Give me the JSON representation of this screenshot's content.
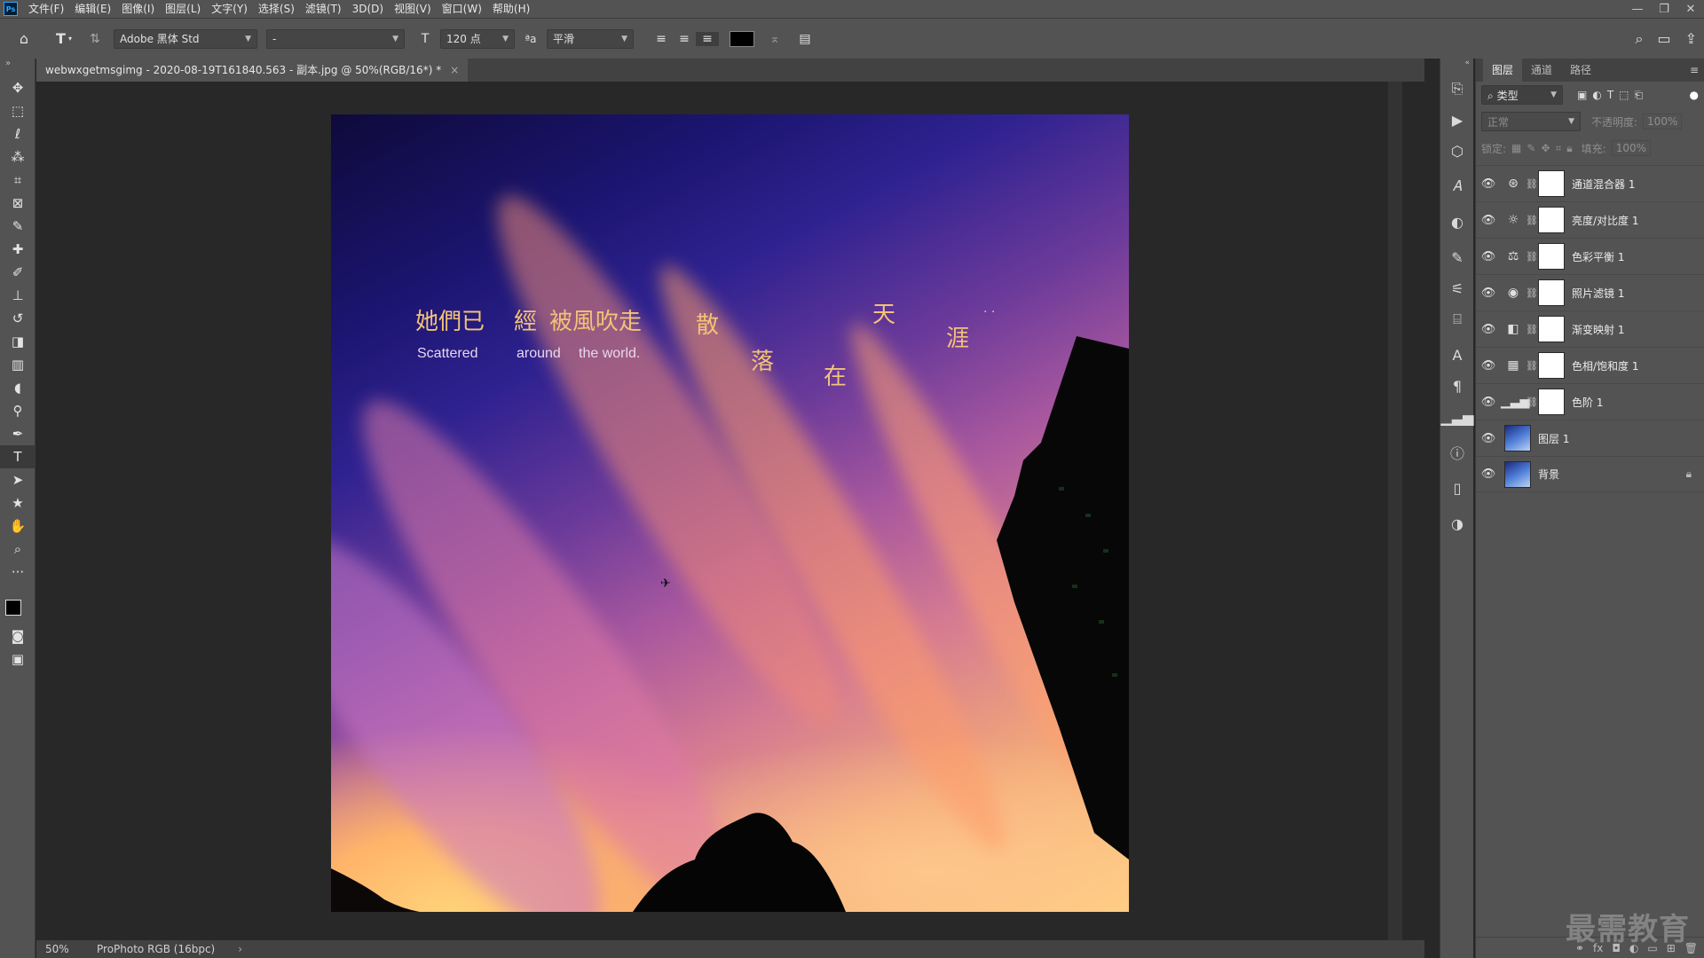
{
  "menubar": {
    "logo": "Ps",
    "items": [
      "文件(F)",
      "编辑(E)",
      "图像(I)",
      "图层(L)",
      "文字(Y)",
      "选择(S)",
      "滤镜(T)",
      "3D(D)",
      "视图(V)",
      "窗口(W)",
      "帮助(H)"
    ]
  },
  "options": {
    "font_family": "Adobe 黑体 Std",
    "font_style": "-",
    "font_size": "120 点",
    "antialias": "平滑",
    "text_color": "#000000"
  },
  "document": {
    "tab_title": "webwxgetmsgimg - 2020-08-19T161840.563 - 副本.jpg @ 50%(RGB/16*) *",
    "zoom": "50%",
    "color_profile": "ProPhoto RGB (16bpc)"
  },
  "artwork": {
    "line1": "她們已",
    "line2": "經",
    "line3": "被風吹走",
    "en1": "Scattered",
    "en2": "around",
    "en3": "the world.",
    "c1": "散",
    "c2": "落",
    "c3": "在",
    "c4": "天",
    "c5": "涯",
    "dots": "· ·"
  },
  "layers_panel": {
    "tabs": [
      "图层",
      "通道",
      "路径"
    ],
    "filter_kind": "类型",
    "blend_mode": "正常",
    "opacity_label": "不透明度:",
    "opacity_value": "100%",
    "lock_label": "锁定:",
    "fill_label": "填充:",
    "fill_value": "100%",
    "layers": [
      {
        "name": "通道混合器 1",
        "icon": "channel-mixer-icon"
      },
      {
        "name": "亮度/对比度 1",
        "icon": "brightness-icon"
      },
      {
        "name": "色彩平衡 1",
        "icon": "color-balance-icon"
      },
      {
        "name": "照片滤镜 1",
        "icon": "photo-filter-icon"
      },
      {
        "name": "渐变映射 1",
        "icon": "gradient-map-icon"
      },
      {
        "name": "色相/饱和度 1",
        "icon": "hue-saturation-icon"
      },
      {
        "name": "色阶 1",
        "icon": "levels-icon"
      },
      {
        "name": "图层 1",
        "icon": "image-thumbnail"
      },
      {
        "name": "背景",
        "icon": "image-thumbnail"
      }
    ]
  },
  "watermark": "最需教育"
}
